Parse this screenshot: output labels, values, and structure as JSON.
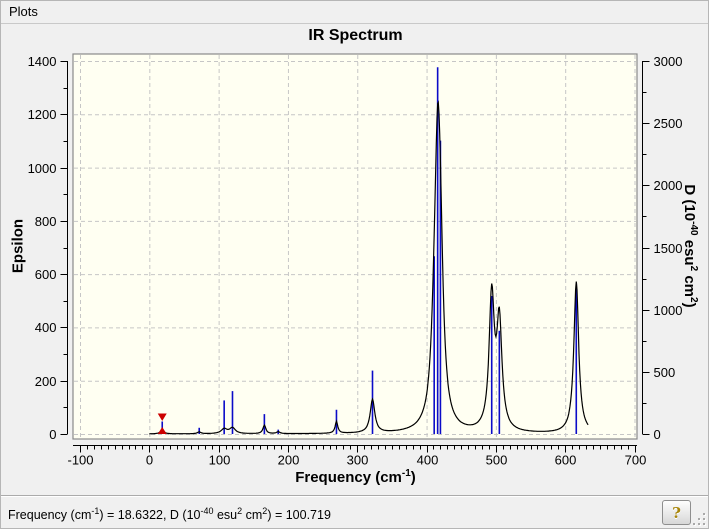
{
  "menu": {
    "items": [
      {
        "label": "Plots"
      }
    ]
  },
  "chart": {
    "title": "IR Spectrum",
    "x_axis": {
      "label_parts": [
        "Frequency (cm",
        "-1",
        ")"
      ],
      "min": -100,
      "max": 700,
      "major_step": 100,
      "minor_step": 10
    },
    "y_left": {
      "label": "Epsilon",
      "min": 0,
      "max": 1400,
      "major_step": 200,
      "minor_step": 100
    },
    "y_right": {
      "label_parts": [
        "D (10",
        "-40",
        " esu",
        "2",
        " cm",
        "2",
        ")"
      ],
      "min": 0,
      "max": 3000,
      "major_step": 500,
      "minor_step": 250
    }
  },
  "chart_data": {
    "type": "line+stick",
    "title": "IR Spectrum",
    "xlabel": "Frequency (cm^-1)",
    "ylabel_left": "Epsilon",
    "ylabel_right": "D (10^-40 esu^2 cm^2)",
    "x_range": [
      -100,
      700
    ],
    "y_left_range": [
      0,
      1400
    ],
    "y_right_range": [
      0,
      3000
    ],
    "grid": "dashed, at every major tick",
    "sticks_D": [
      [
        18.6322,
        100.719
      ],
      [
        72,
        50
      ],
      [
        108,
        270
      ],
      [
        120,
        345
      ],
      [
        166,
        160
      ],
      [
        186,
        35
      ],
      [
        270,
        195
      ],
      [
        322,
        510
      ],
      [
        411,
        1430
      ],
      [
        416,
        2950
      ],
      [
        420,
        2360
      ],
      [
        494,
        1110
      ],
      [
        505,
        830
      ],
      [
        616,
        1210
      ]
    ],
    "envelope_lorentzians_eps": [
      [
        18.6,
        15,
        3
      ],
      [
        72,
        7,
        3
      ],
      [
        108,
        18,
        5
      ],
      [
        120,
        22,
        5
      ],
      [
        166,
        32,
        2.5
      ],
      [
        186,
        7,
        3
      ],
      [
        270,
        45,
        2.3
      ],
      [
        322,
        125,
        4
      ],
      [
        411,
        150,
        5
      ],
      [
        416,
        930,
        5.5
      ],
      [
        420,
        380,
        5
      ],
      [
        494,
        500,
        4.5
      ],
      [
        505,
        400,
        4.5
      ],
      [
        616,
        570,
        4.2
      ]
    ],
    "curve_domain": [
      0,
      633
    ],
    "cursor": {
      "frequency": 18.6322,
      "D": 100.719
    }
  },
  "status_bar": {
    "text_parts": [
      "Frequency (cm",
      "-1",
      ") = 18.6322, D (10",
      "-40",
      " esu",
      "2",
      " cm",
      "2",
      ") = 100.719"
    ],
    "help_glyph": "?"
  },
  "colors": {
    "window_bg": "#f0f0f0",
    "canvas_bg": "#fffff2",
    "frame": "#8a8a8a",
    "grid": "#c6c6c6",
    "curve": "#000000",
    "stick": "#0b0bc8",
    "marker": "#cc0000",
    "text": "#000000"
  }
}
